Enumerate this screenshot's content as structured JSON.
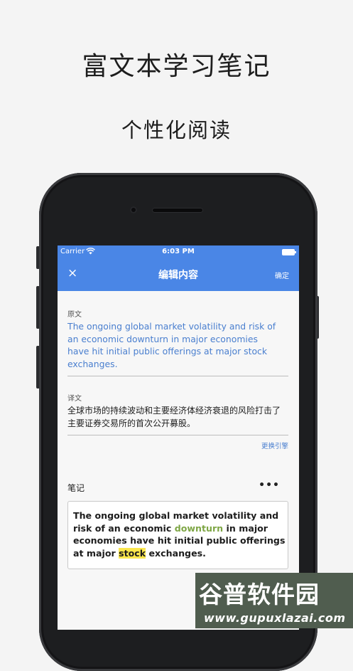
{
  "headline": {
    "title": "富文本学习笔记",
    "subtitle": "个性化阅读"
  },
  "status_bar": {
    "carrier": "Carrier",
    "time": "6:03 PM"
  },
  "nav": {
    "close_icon": "×",
    "title": "编辑内容",
    "confirm": "确定"
  },
  "original": {
    "label": "原文",
    "text": "The ongoing global market volatility and risk of an economic downturn in major economies have hit initial public offerings at major stock exchanges."
  },
  "translation": {
    "label": "译文",
    "text": "全球市场的持续波动和主要经济体经济衰退的风险打击了主要证券交易所的首次公开募股。"
  },
  "switch_engine": "更换引擎",
  "notes": {
    "label": "笔记",
    "more_icon": "•••",
    "text_part1": "The ongoing global market volatility and risk of an economic ",
    "highlight_green": "downturn",
    "text_part2": " in major economies have hit initial public offerings at major ",
    "highlight_yellow": "stock",
    "text_part3": " exchanges."
  },
  "watermark": {
    "text": "谷普软件园",
    "url": "www.gupuxlazai.com"
  },
  "colors": {
    "accent": "#4a86e6",
    "link": "#4a7fcf",
    "highlight_green": "#7ea645",
    "highlight_yellow": "#fbe74d"
  }
}
